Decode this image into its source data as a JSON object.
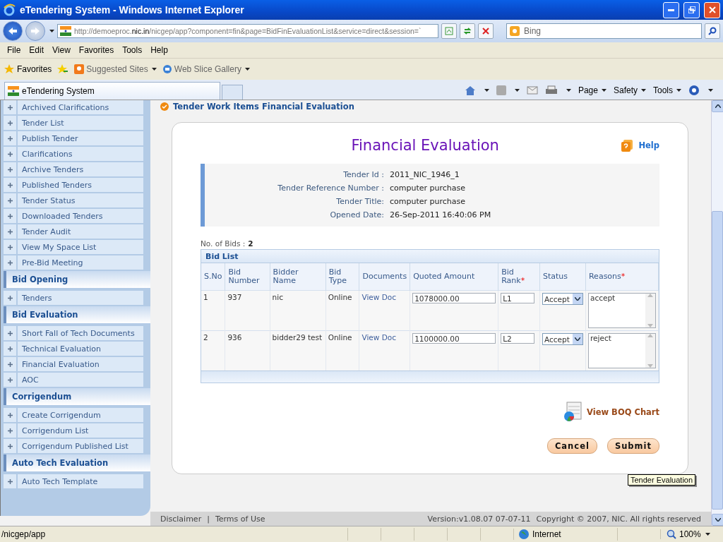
{
  "window": {
    "title": "eTendering System - Windows Internet Explorer"
  },
  "address_bar": {
    "url_prefix": "http://demoeproc.",
    "url_host": "nic.in",
    "url_rest": "/nicgep/app?component=fin&page=BidFinEvaluationList&service=direct&session=`",
    "search_placeholder": "Bing"
  },
  "menu": [
    "File",
    "Edit",
    "View",
    "Favorites",
    "Tools",
    "Help"
  ],
  "favorites_bar": {
    "favorites": "Favorites",
    "links": [
      "Suggested Sites",
      "Web Slice Gallery"
    ]
  },
  "browser_tab": {
    "label": "eTendering System"
  },
  "command_bar": [
    "Page",
    "Safety",
    "Tools"
  ],
  "sidebar": {
    "groups": [
      {
        "items": [
          "Archived Clarifications",
          "Tender List",
          "Publish Tender",
          "Clarifications",
          "Archive Tenders",
          "Published Tenders",
          "Tender Status",
          "Downloaded Tenders",
          "Tender Audit",
          "View My Space List",
          "Pre-Bid Meeting"
        ]
      },
      {
        "title": "Bid Opening",
        "items": [
          "Tenders"
        ]
      },
      {
        "title": "Bid Evaluation",
        "items": [
          "Short Fall of Tech Documents",
          "Technical Evaluation",
          "Financial Evaluation",
          "AOC"
        ]
      },
      {
        "title": "Corrigendum",
        "items": [
          "Create Corrigendum",
          "Corrigendum List",
          "Corrigendum Published List"
        ]
      },
      {
        "title": "Auto Tech Evaluation",
        "items": [
          "Auto Tech Template"
        ]
      }
    ]
  },
  "breadcrumb": "Tender Work Items Financial Evaluation",
  "page_title": "Financial Evaluation",
  "help": "Help",
  "details": [
    {
      "label": "Tender Id :",
      "value": "2011_NIC_1946_1"
    },
    {
      "label": "Tender Reference Number :",
      "value": "computer purchase"
    },
    {
      "label": "Tender Title:",
      "value": "computer purchase"
    },
    {
      "label": "Opened Date:",
      "value": "26-Sep-2011 16:40:06 PM"
    }
  ],
  "bid_count": {
    "label": "No. of Bids :",
    "value": "2"
  },
  "table": {
    "title": "Bid List",
    "columns": [
      {
        "label": "S.No"
      },
      {
        "label": "Bid Number"
      },
      {
        "label": "Bidder Name"
      },
      {
        "label": "Bid Type"
      },
      {
        "label": "Documents"
      },
      {
        "label": "Quoted Amount"
      },
      {
        "label": "Bid Rank",
        "required_mark": "*"
      },
      {
        "label": "Status"
      },
      {
        "label": "Reasons",
        "required_mark": "*"
      }
    ],
    "rows": [
      {
        "sno": "1",
        "bid_number": "937",
        "bidder_name": "nic",
        "bid_type": "Online",
        "documents": "View Doc",
        "quoted_amount": "1078000.00",
        "bid_rank": "L1",
        "status": "Accept",
        "reasons": "accept"
      },
      {
        "sno": "2",
        "bid_number": "936",
        "bidder_name": "bidder29 test",
        "bid_type": "Online",
        "documents": "View Doc",
        "quoted_amount": "1100000.00",
        "bid_rank": "L2",
        "status": "Accept",
        "reasons": "reject"
      }
    ]
  },
  "boq_link": "View BOQ Chart",
  "buttons": [
    "Cancel",
    "Submit"
  ],
  "tooltip": "Tender Evaluation",
  "footer": {
    "links": [
      "Disclaimer",
      "Terms of Use"
    ],
    "separator": "|",
    "version": "Version:v1.08.07 07-07-11",
    "copyright": "Copyright © 2007, NIC. All rights reserved"
  },
  "status_bar": {
    "path": "/nicgep/app",
    "zone": "Internet",
    "zoom": "100%"
  }
}
